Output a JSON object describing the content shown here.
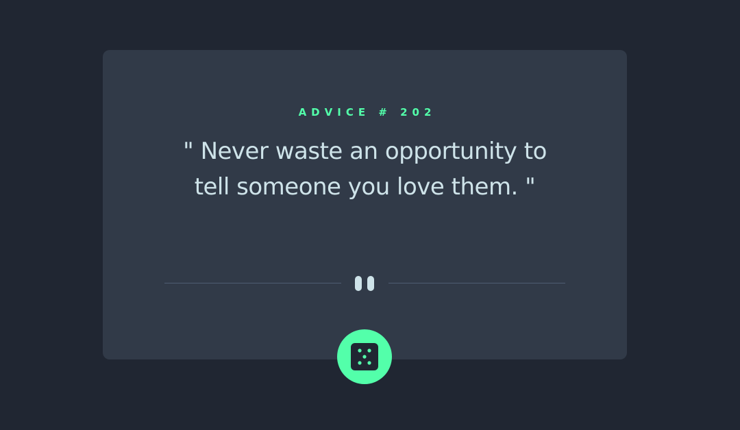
{
  "advice": {
    "label": "ADVICE # 202",
    "quote": "\" Never waste an opportunity to tell someone you love them. \""
  },
  "icons": {
    "divider": "pause-icon",
    "button": "dice-icon"
  },
  "colors": {
    "background": "#202632",
    "card": "#313a48",
    "accent": "#53ffaa",
    "text": "#cee3e9",
    "divider": "#4f5d74"
  }
}
